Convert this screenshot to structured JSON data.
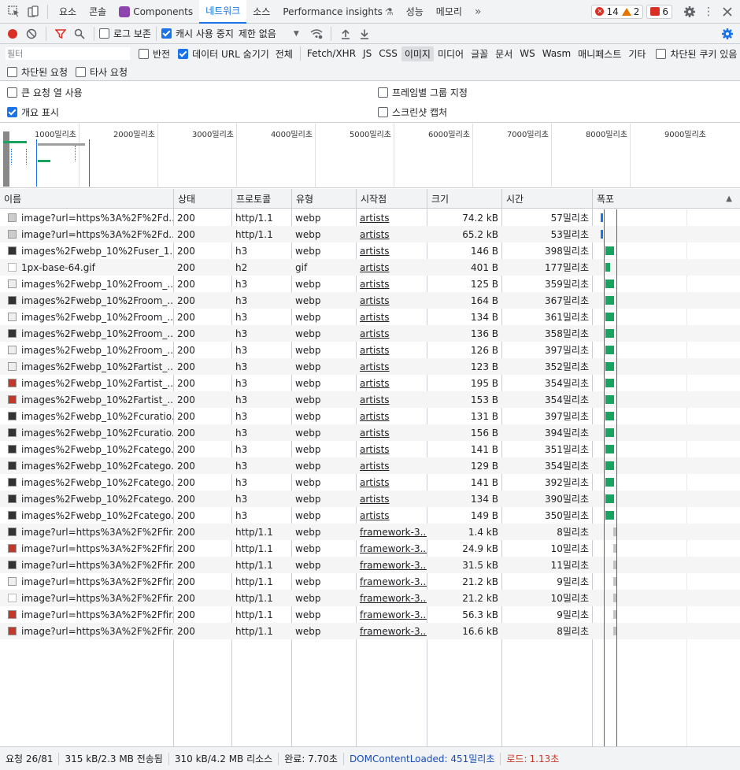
{
  "tabs": [
    "요소",
    "콘솔",
    "Components",
    "네트워크",
    "소스",
    "Performance insights",
    "성능",
    "메모리"
  ],
  "active_tab": "네트워크",
  "more_tabs": "»",
  "badges": {
    "errors": "14",
    "warnings": "2",
    "issues": "6"
  },
  "toolbar": {
    "preserve_log": "로그 보존",
    "disable_cache": "캐시 사용 중지",
    "throttle": "제한 없음"
  },
  "filter": {
    "placeholder": "필터",
    "invert": "반전",
    "hide_data_urls": "데이터 URL 숨기기",
    "types": [
      "전체",
      "Fetch/XHR",
      "JS",
      "CSS",
      "이미지",
      "미디어",
      "글꼴",
      "문서",
      "WS",
      "Wasm",
      "매니페스트",
      "기타"
    ],
    "active_type": "이미지",
    "blocked_cookies": "차단된 쿠키 있음",
    "blocked_requests": "차단된 요청",
    "third_party": "타사 요청"
  },
  "settings": {
    "big_rows": "큰 요청 열 사용",
    "group_by_frame": "프레임별 그룹 지정",
    "show_overview": "개요 표시",
    "capture_screenshots": "스크린샷 캡처"
  },
  "overview_labels": [
    "1000밀리초",
    "2000밀리초",
    "3000밀리초",
    "4000밀리초",
    "5000밀리초",
    "6000밀리초",
    "7000밀리초",
    "8000밀리초",
    "9000밀리초"
  ],
  "columns": [
    "이름",
    "상태",
    "프로토콜",
    "유형",
    "시작점",
    "크기",
    "시간",
    "폭포"
  ],
  "rows": [
    {
      "name": "image?url=https%3A%2F%2Fd...",
      "status": "200",
      "protocol": "http/1.1",
      "type": "webp",
      "initiator": "artists",
      "size": "74.2 kB",
      "time": "57밀리초",
      "thumb": "gray"
    },
    {
      "name": "image?url=https%3A%2F%2Fd...",
      "status": "200",
      "protocol": "http/1.1",
      "type": "webp",
      "initiator": "artists",
      "size": "65.2 kB",
      "time": "53밀리초",
      "thumb": "gray"
    },
    {
      "name": "images%2Fwebp_10%2Fuser_1...",
      "status": "200",
      "protocol": "h3",
      "type": "webp",
      "initiator": "artists",
      "size": "146 B",
      "time": "398밀리초",
      "thumb": "dark"
    },
    {
      "name": "1px-base-64.gif",
      "status": "200",
      "protocol": "h2",
      "type": "gif",
      "initiator": "artists",
      "size": "401 B",
      "time": "177밀리초",
      "thumb": "white"
    },
    {
      "name": "images%2Fwebp_10%2Froom_...",
      "status": "200",
      "protocol": "h3",
      "type": "webp",
      "initiator": "artists",
      "size": "125 B",
      "time": "359밀리초",
      "thumb": "light"
    },
    {
      "name": "images%2Fwebp_10%2Froom_...",
      "status": "200",
      "protocol": "h3",
      "type": "webp",
      "initiator": "artists",
      "size": "164 B",
      "time": "367밀리초",
      "thumb": "dark"
    },
    {
      "name": "images%2Fwebp_10%2Froom_...",
      "status": "200",
      "protocol": "h3",
      "type": "webp",
      "initiator": "artists",
      "size": "134 B",
      "time": "361밀리초",
      "thumb": "light"
    },
    {
      "name": "images%2Fwebp_10%2Froom_...",
      "status": "200",
      "protocol": "h3",
      "type": "webp",
      "initiator": "artists",
      "size": "136 B",
      "time": "358밀리초",
      "thumb": "dark"
    },
    {
      "name": "images%2Fwebp_10%2Froom_...",
      "status": "200",
      "protocol": "h3",
      "type": "webp",
      "initiator": "artists",
      "size": "126 B",
      "time": "397밀리초",
      "thumb": "light"
    },
    {
      "name": "images%2Fwebp_10%2Fartist_...",
      "status": "200",
      "protocol": "h3",
      "type": "webp",
      "initiator": "artists",
      "size": "123 B",
      "time": "352밀리초",
      "thumb": "light"
    },
    {
      "name": "images%2Fwebp_10%2Fartist_...",
      "status": "200",
      "protocol": "h3",
      "type": "webp",
      "initiator": "artists",
      "size": "195 B",
      "time": "354밀리초",
      "thumb": "red"
    },
    {
      "name": "images%2Fwebp_10%2Fartist_...",
      "status": "200",
      "protocol": "h3",
      "type": "webp",
      "initiator": "artists",
      "size": "153 B",
      "time": "354밀리초",
      "thumb": "red"
    },
    {
      "name": "images%2Fwebp_10%2Fcuratio...",
      "status": "200",
      "protocol": "h3",
      "type": "webp",
      "initiator": "artists",
      "size": "131 B",
      "time": "397밀리초",
      "thumb": "dark"
    },
    {
      "name": "images%2Fwebp_10%2Fcuratio...",
      "status": "200",
      "protocol": "h3",
      "type": "webp",
      "initiator": "artists",
      "size": "156 B",
      "time": "394밀리초",
      "thumb": "dark"
    },
    {
      "name": "images%2Fwebp_10%2Fcatego...",
      "status": "200",
      "protocol": "h3",
      "type": "webp",
      "initiator": "artists",
      "size": "141 B",
      "time": "351밀리초",
      "thumb": "dark"
    },
    {
      "name": "images%2Fwebp_10%2Fcatego...",
      "status": "200",
      "protocol": "h3",
      "type": "webp",
      "initiator": "artists",
      "size": "129 B",
      "time": "354밀리초",
      "thumb": "dark"
    },
    {
      "name": "images%2Fwebp_10%2Fcatego...",
      "status": "200",
      "protocol": "h3",
      "type": "webp",
      "initiator": "artists",
      "size": "141 B",
      "time": "392밀리초",
      "thumb": "dark"
    },
    {
      "name": "images%2Fwebp_10%2Fcatego...",
      "status": "200",
      "protocol": "h3",
      "type": "webp",
      "initiator": "artists",
      "size": "134 B",
      "time": "390밀리초",
      "thumb": "dark"
    },
    {
      "name": "images%2Fwebp_10%2Fcatego...",
      "status": "200",
      "protocol": "h3",
      "type": "webp",
      "initiator": "artists",
      "size": "149 B",
      "time": "350밀리초",
      "thumb": "dark"
    },
    {
      "name": "image?url=https%3A%2F%2Ffir...",
      "status": "200",
      "protocol": "http/1.1",
      "type": "webp",
      "initiator": "framework-3...",
      "size": "1.4 kB",
      "time": "8밀리초",
      "thumb": "dark"
    },
    {
      "name": "image?url=https%3A%2F%2Ffir...",
      "status": "200",
      "protocol": "http/1.1",
      "type": "webp",
      "initiator": "framework-3...",
      "size": "24.9 kB",
      "time": "10밀리초",
      "thumb": "red"
    },
    {
      "name": "image?url=https%3A%2F%2Ffir...",
      "status": "200",
      "protocol": "http/1.1",
      "type": "webp",
      "initiator": "framework-3...",
      "size": "31.5 kB",
      "time": "11밀리초",
      "thumb": "dark"
    },
    {
      "name": "image?url=https%3A%2F%2Ffir...",
      "status": "200",
      "protocol": "http/1.1",
      "type": "webp",
      "initiator": "framework-3...",
      "size": "21.2 kB",
      "time": "9밀리초",
      "thumb": "light"
    },
    {
      "name": "image?url=https%3A%2F%2Ffir...",
      "status": "200",
      "protocol": "http/1.1",
      "type": "webp",
      "initiator": "framework-3...",
      "size": "21.2 kB",
      "time": "10밀리초",
      "thumb": "white"
    },
    {
      "name": "image?url=https%3A%2F%2Ffir...",
      "status": "200",
      "protocol": "http/1.1",
      "type": "webp",
      "initiator": "framework-3...",
      "size": "56.3 kB",
      "time": "9밀리초",
      "thumb": "red"
    },
    {
      "name": "image?url=https%3A%2F%2Ffir...",
      "status": "200",
      "protocol": "http/1.1",
      "type": "webp",
      "initiator": "framework-3...",
      "size": "16.6 kB",
      "time": "8밀리초",
      "thumb": "red"
    }
  ],
  "status": {
    "requests": "요청 26/81",
    "transferred": "315 kB/2.3 MB 전송됨",
    "resources": "310 kB/4.2 MB 리소스",
    "finish": "완료: 7.70초",
    "dcl": "DOMContentLoaded: 451밀리초",
    "load_label": "로드:",
    "load_value": "1.13초"
  },
  "colors": {
    "accent": "#1a73e8",
    "record": "#d93025",
    "waterfall_green": "#1aa260",
    "dcl_line": "#1a73e8",
    "load_line": "#c53929"
  }
}
